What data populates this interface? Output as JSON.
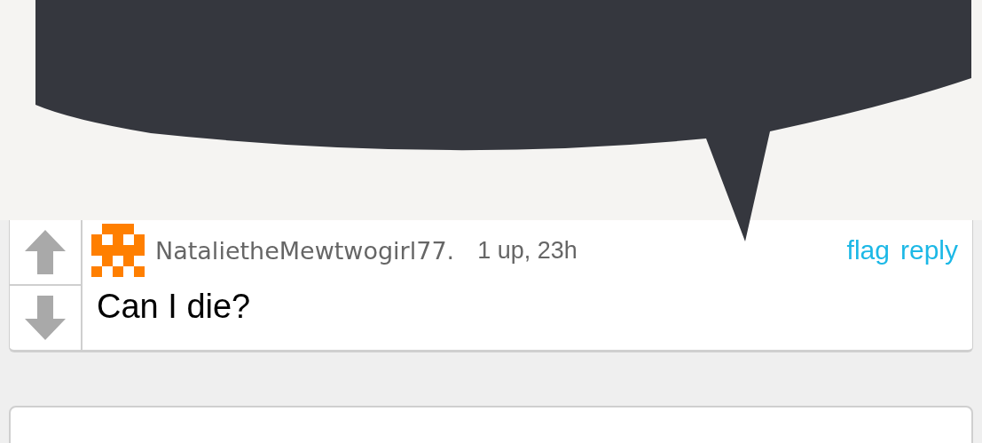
{
  "comment": {
    "username": "NatalietheMewtwogirl77.",
    "meta": "1 up, 23h",
    "actions": [
      "flag",
      "reply"
    ],
    "text": "Can I die?"
  }
}
